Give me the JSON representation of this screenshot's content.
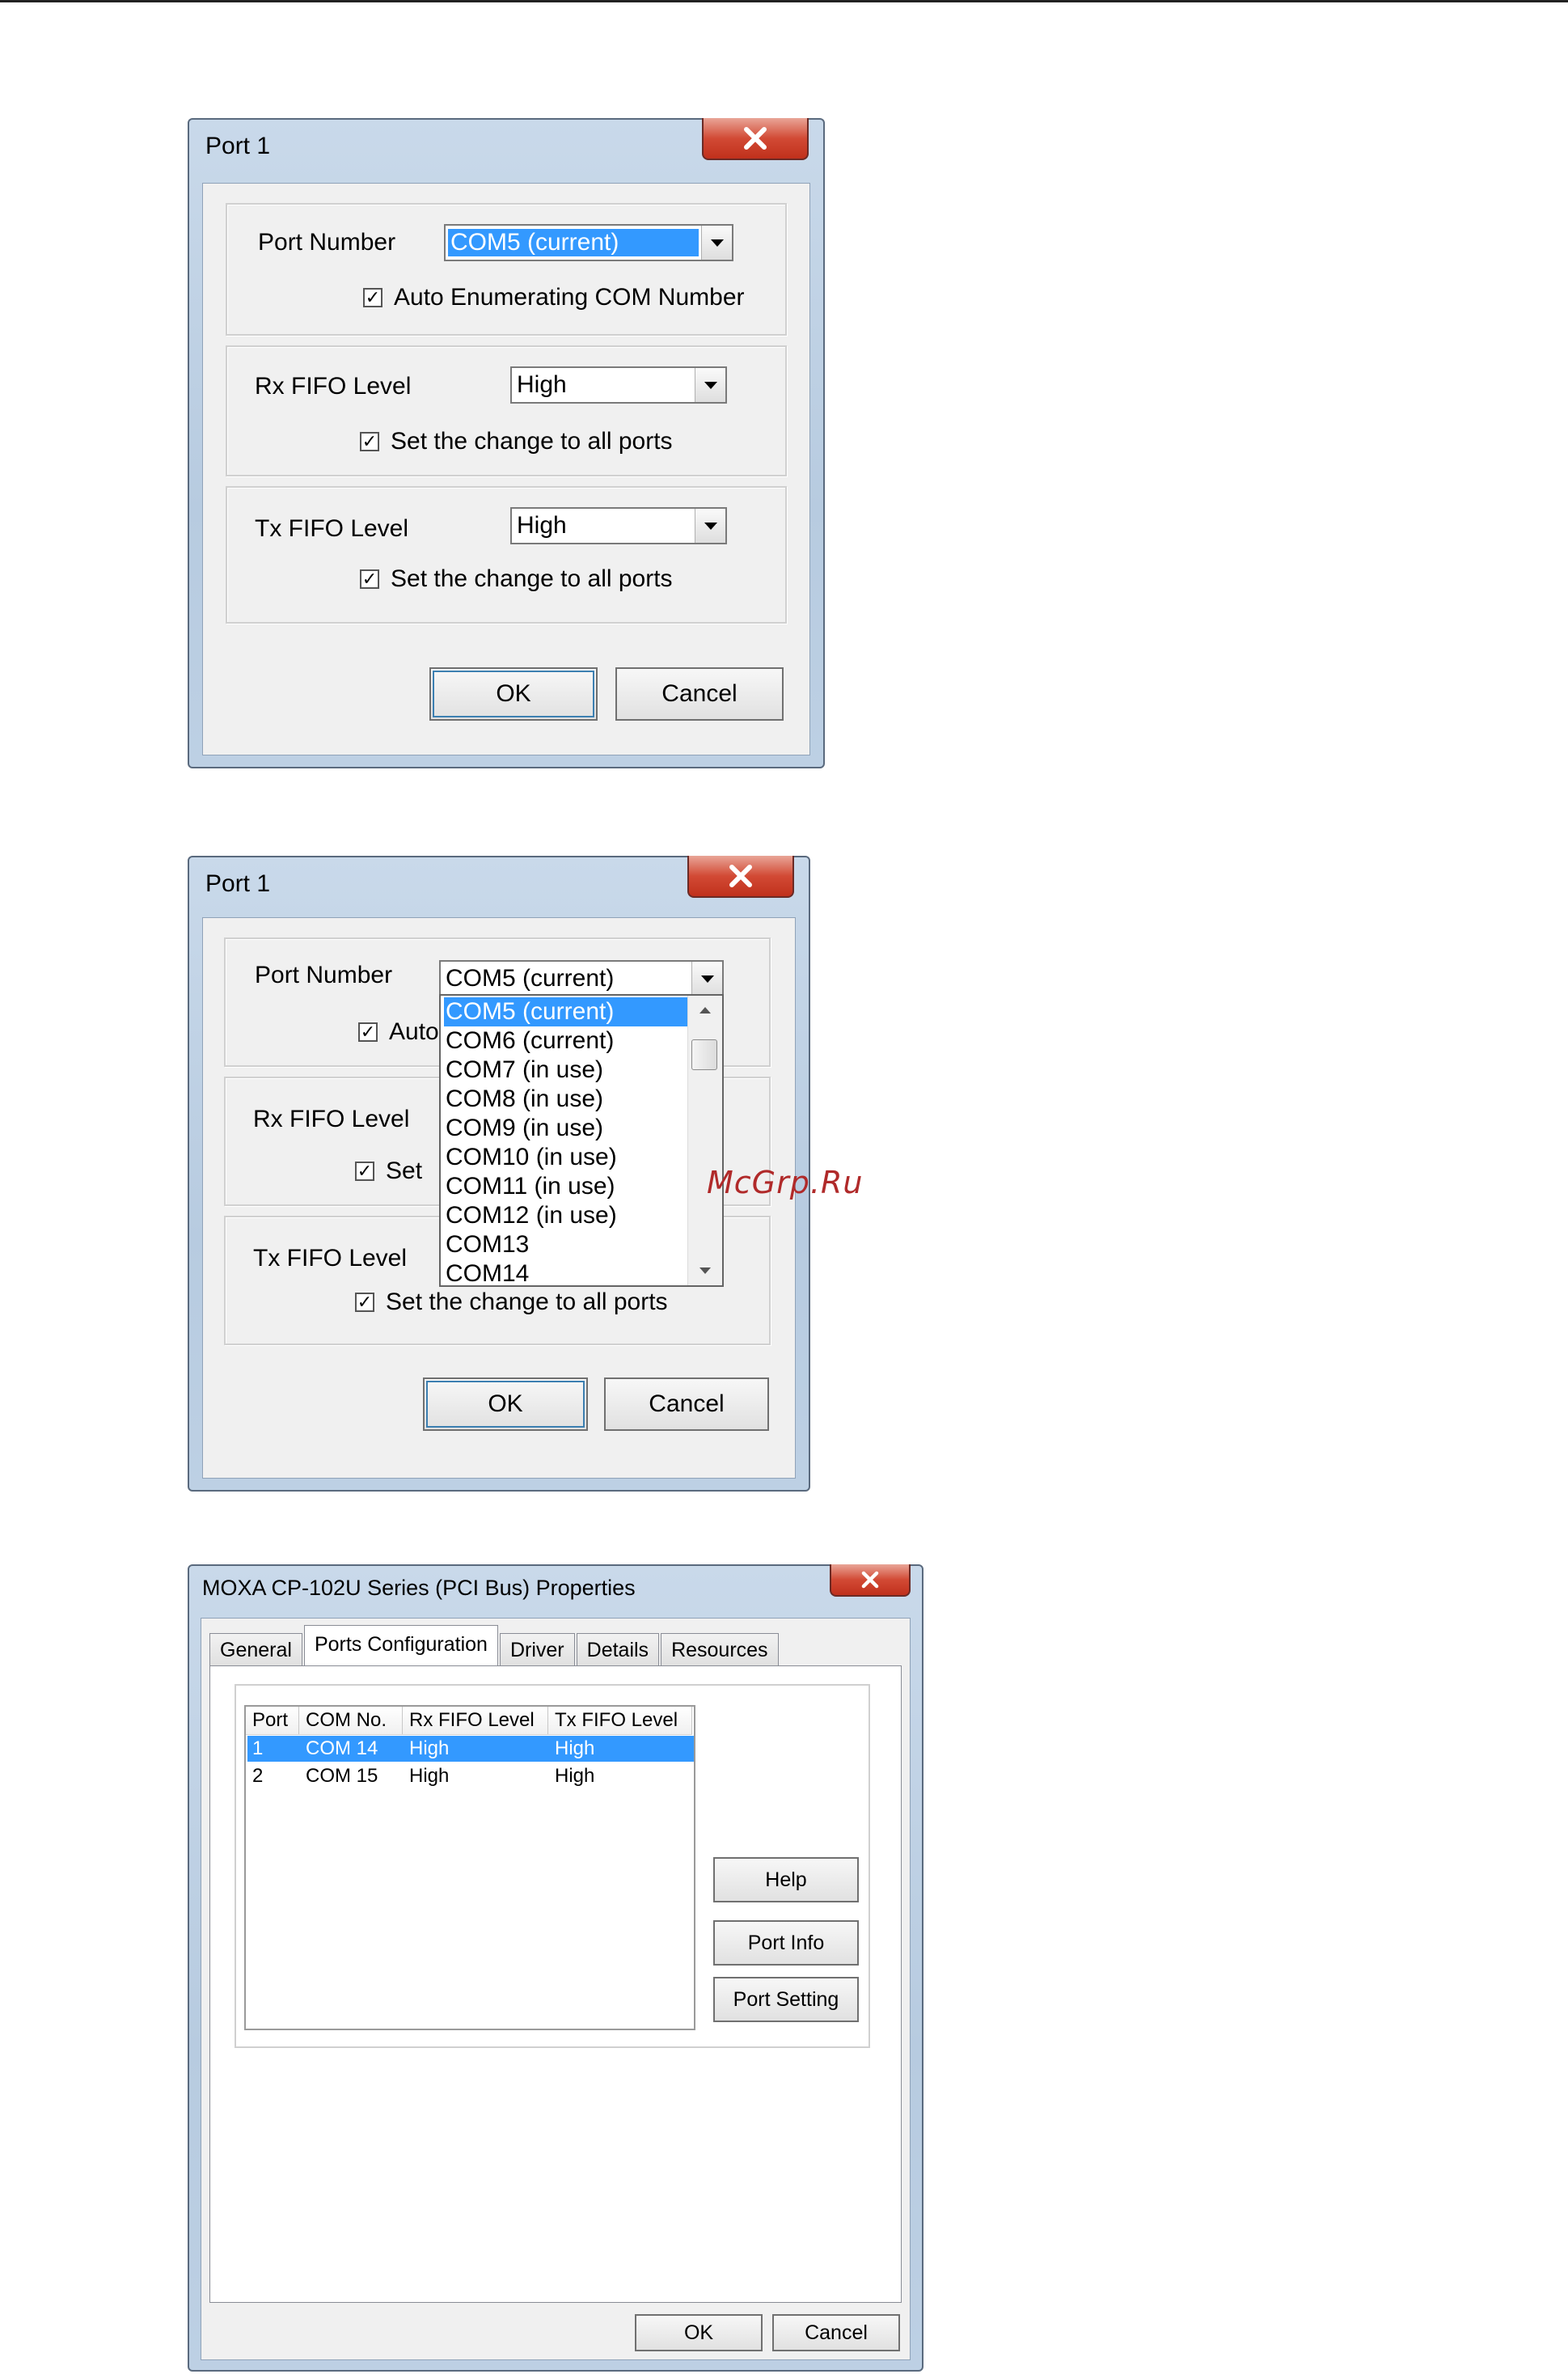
{
  "dialog1": {
    "title": "Port 1",
    "port_number_label": "Port Number",
    "port_number_value": "COM5 (current)",
    "auto_enum_label": "Auto Enumerating COM Number",
    "rx_label": "Rx FIFO Level",
    "rx_value": "High",
    "rx_set_all_label": "Set the change to all ports",
    "tx_label": "Tx FIFO Level",
    "tx_value": "High",
    "tx_set_all_label": "Set the change to all ports",
    "ok_label": "OK",
    "cancel_label": "Cancel",
    "checked_mark": "✓"
  },
  "dialog2": {
    "title": "Port 1",
    "port_number_label": "Port Number",
    "port_number_value": "COM5 (current)",
    "auto_enum_partial": "Auto",
    "rx_label": "Rx FIFO Level",
    "rx_set_partial": "Set",
    "tx_label": "Tx FIFO Level",
    "tx_set_all_label": "Set the change to all ports",
    "ok_label": "OK",
    "cancel_label": "Cancel",
    "dropdown_options": [
      "COM5 (current)",
      "COM6 (current)",
      "COM7 (in use)",
      "COM8 (in use)",
      "COM9 (in use)",
      "COM10 (in use)",
      "COM11 (in use)",
      "COM12 (in use)",
      "COM13",
      "COM14"
    ],
    "selected_option": "COM5 (current)"
  },
  "watermark": "McGrp.Ru",
  "dialog3": {
    "title": "MOXA CP-102U Series (PCI Bus) Properties",
    "tabs": [
      "General",
      "Ports Configuration",
      "Driver",
      "Details",
      "Resources"
    ],
    "active_tab": "Ports Configuration",
    "columns": [
      "Port",
      "COM No.",
      "Rx FIFO Level",
      "Tx FIFO Level"
    ],
    "rows": [
      [
        "1",
        "COM 14",
        "High",
        "High"
      ],
      [
        "2",
        "COM 15",
        "High",
        "High"
      ]
    ],
    "selected_row": "1",
    "help_label": "Help",
    "port_info_label": "Port Info",
    "port_setting_label": "Port Setting",
    "ok_label": "OK",
    "cancel_label": "Cancel"
  },
  "colors": {
    "selection": "#3399ff",
    "close_button": "#d24a35",
    "frame": "#b7cbe0"
  }
}
